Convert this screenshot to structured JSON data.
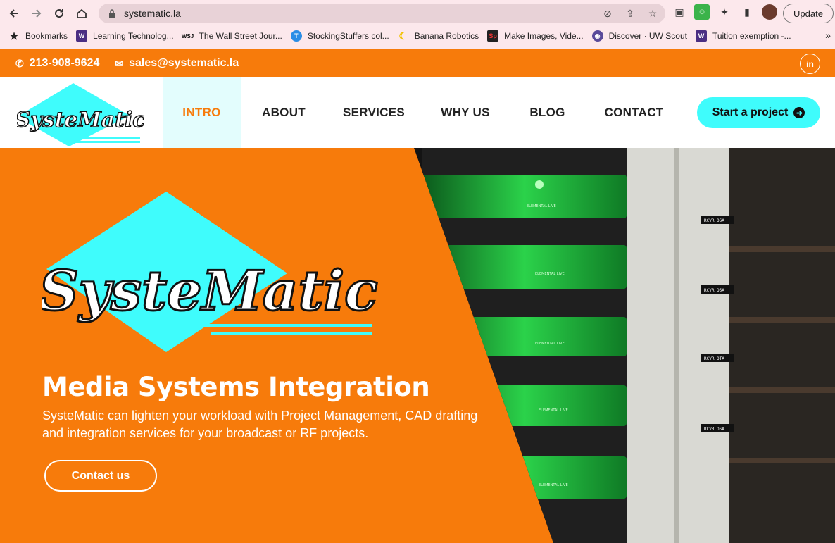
{
  "browser": {
    "url": "systematic.la",
    "update_label": "Update",
    "bookmarks": [
      {
        "label": "Bookmarks",
        "icon": "star-icon"
      },
      {
        "label": "Learning Technolog...",
        "icon": "w-icon"
      },
      {
        "label": "The Wall Street Jour...",
        "icon": "wsj-icon"
      },
      {
        "label": "StockingStuffers col...",
        "icon": "t-icon"
      },
      {
        "label": "Banana Robotics",
        "icon": "banana-icon"
      },
      {
        "label": "Make Images, Vide...",
        "icon": "sp-icon"
      },
      {
        "label": "Discover · UW Scout",
        "icon": "scout-icon"
      },
      {
        "label": "Tuition exemption -...",
        "icon": "w-icon"
      }
    ],
    "bookmark_icon_text": {
      "w": "W",
      "wsj": "WSJ",
      "sp": "Sp"
    }
  },
  "topbar": {
    "phone": "213-908-9624",
    "email": "sales@systematic.la",
    "linkedin": "in"
  },
  "logo": {
    "text": "SysteMatic"
  },
  "nav": {
    "items": [
      "INTRO",
      "ABOUT",
      "SERVICES",
      "WHY US",
      "BLOG",
      "CONTACT"
    ],
    "active": "INTRO",
    "cta": "Start a project"
  },
  "hero": {
    "title": "Media Systems Integration",
    "text": "SysteMatic can lighten your workload with Project Management, CAD drafting and integration services for your broadcast or RF projects.",
    "button": "Contact us",
    "rack_labels": [
      "RCVR OSA",
      "RCVR OSA",
      "RCVR OTA",
      "RCVR OSA"
    ],
    "unit_label": "ELEMENTAL LIVE"
  },
  "colors": {
    "orange": "#f77b0b",
    "cyan": "#3ffcfc",
    "green": "#18c93a"
  }
}
